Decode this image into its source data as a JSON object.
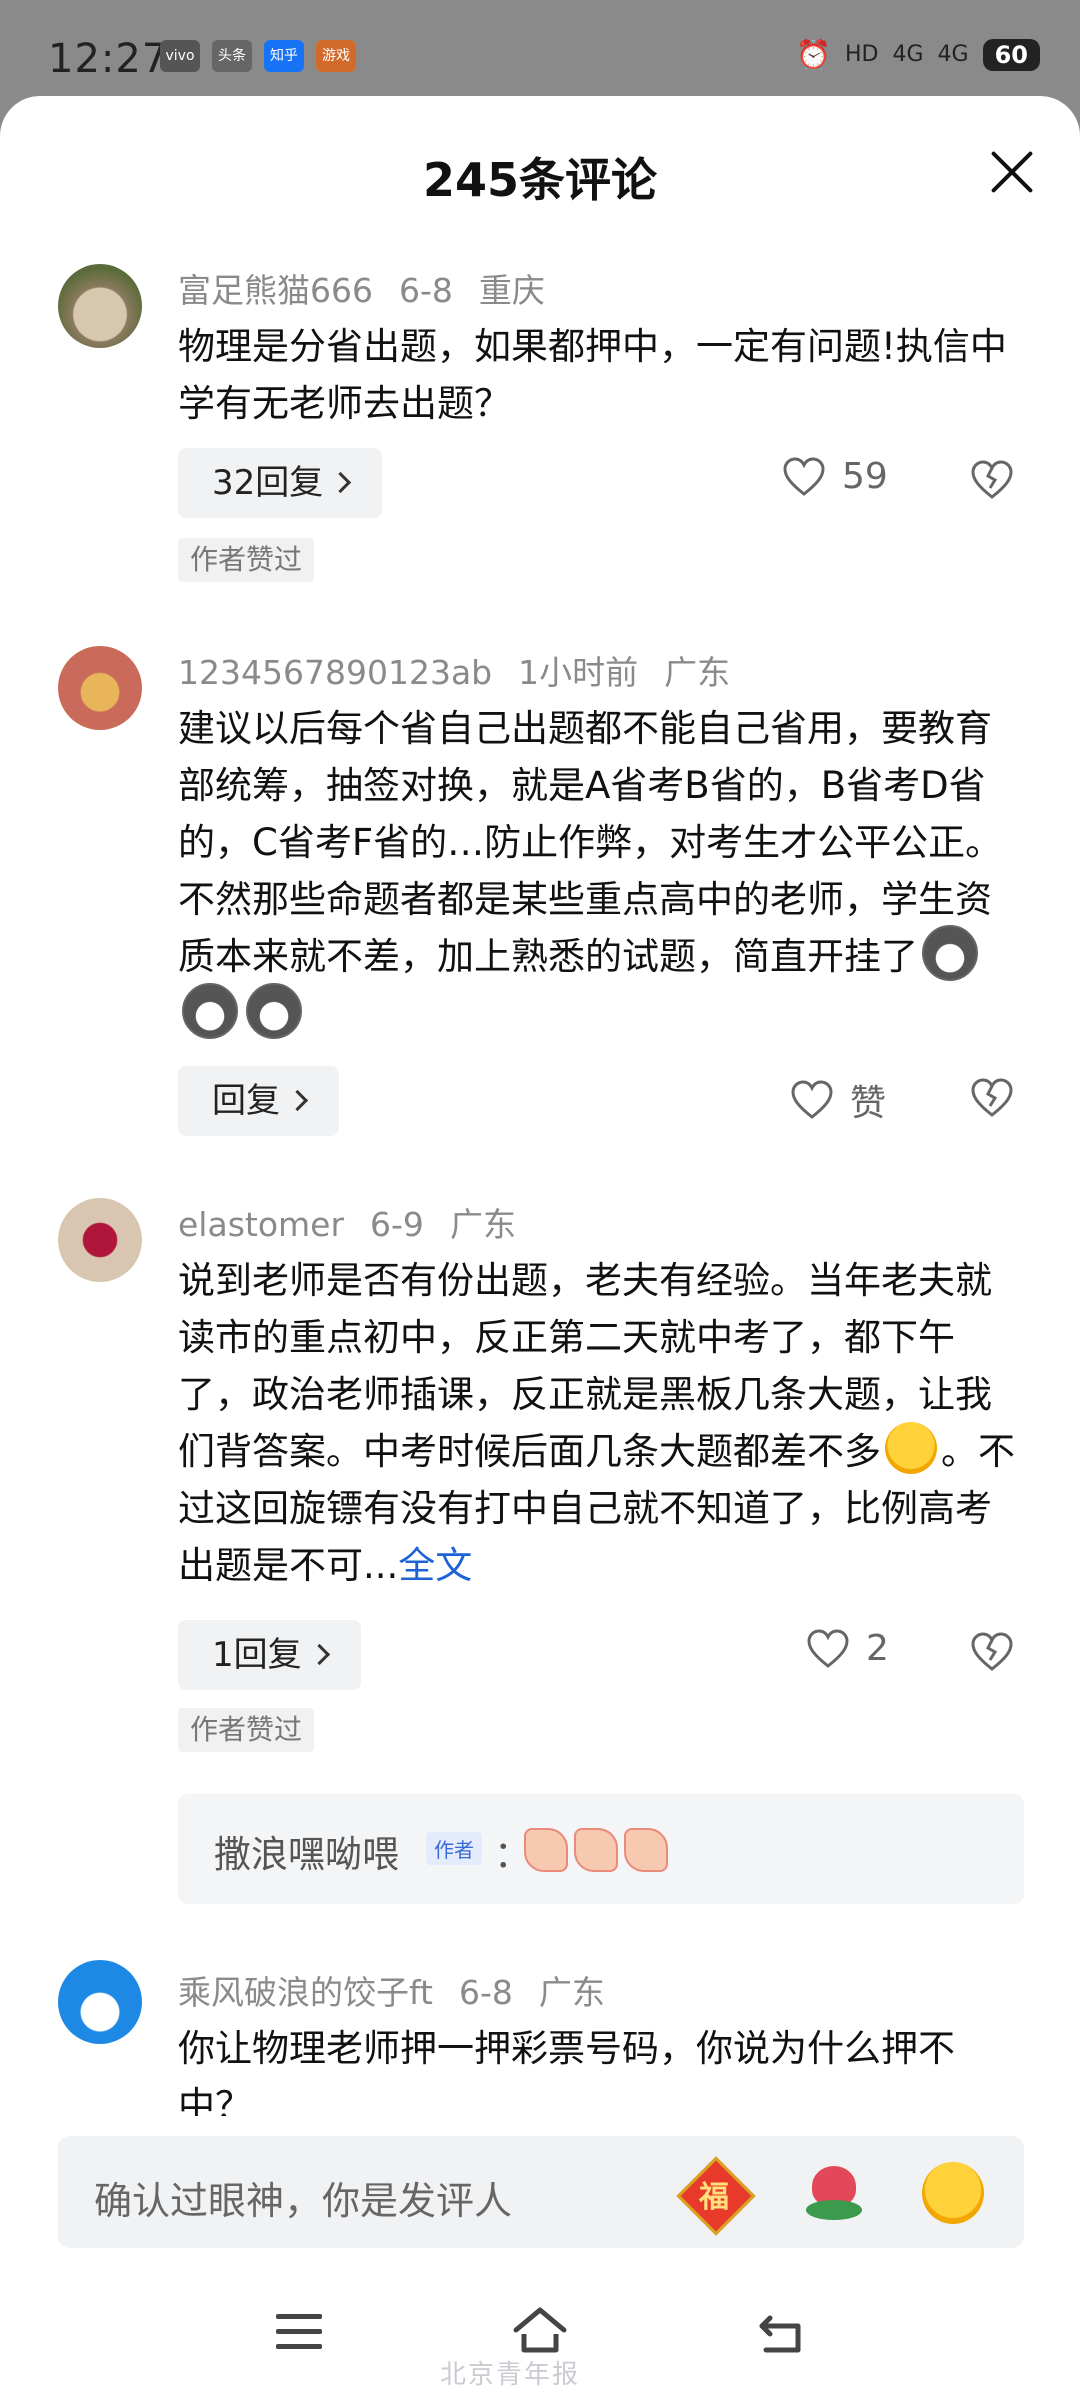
{
  "status_bar": {
    "time": "12:27",
    "apps": [
      "vivo",
      "头条",
      "知乎",
      "游戏"
    ],
    "network": "HD",
    "signal1": "4G",
    "signal2": "4G",
    "battery": "60"
  },
  "sheet": {
    "title": "245条评论"
  },
  "comments": [
    {
      "user": "富足熊猫666",
      "date": "6-8",
      "location": "重庆",
      "text": "物理是分省出题，如果都押中，一定有问题!执信中学有无老师去出题？",
      "reply_label": "32回复",
      "likes": "59",
      "badge": "作者赞过"
    },
    {
      "user": "1234567890123ab",
      "date": "1小时前",
      "location": "广东",
      "text": "建议以后每个省自己出题都不能自己省用，要教育部统筹，抽签对换，就是A省考B省的，B省考D省的，C省考F省的…防止作弊，对考生才公平公正。不然那些命题者都是某些重点高中的老师，学生资质本来就不差，加上熟悉的试题，简直开挂了",
      "reply_label": "回复",
      "likes": "赞"
    },
    {
      "user": "elastomer",
      "date": "6-9",
      "location": "广东",
      "text_a": "说到老师是否有份出题，老夫有经验。当年老夫就读市的重点初中，反正第二天就中考了，都下午了，政治老师插课，反正就是黑板几条大题，让我们背答案。中考时候后面几条大题都差不多",
      "text_b": "。不过这回旋镖有没有打中自己就不知道了，比例高考出题是不可...",
      "full_text_link": "全文",
      "reply_label": "1回复",
      "likes": "2",
      "badge": "作者赞过",
      "sub_reply": {
        "name": "撒浪嘿呦喂",
        "tag": "作者",
        "colon": "："
      }
    },
    {
      "user": "乘风破浪的饺子ft",
      "date": "6-8",
      "location": "广东",
      "text": "你让物理老师押一押彩票号码，你说为什么押不中？"
    }
  ],
  "input": {
    "placeholder": "确认过眼神，你是发评人",
    "quick_fu": "福"
  },
  "icons": {
    "heart": "heart-outline-icon",
    "broken_heart": "broken-heart-icon",
    "close": "close-icon"
  },
  "watermark": "北京青年报"
}
